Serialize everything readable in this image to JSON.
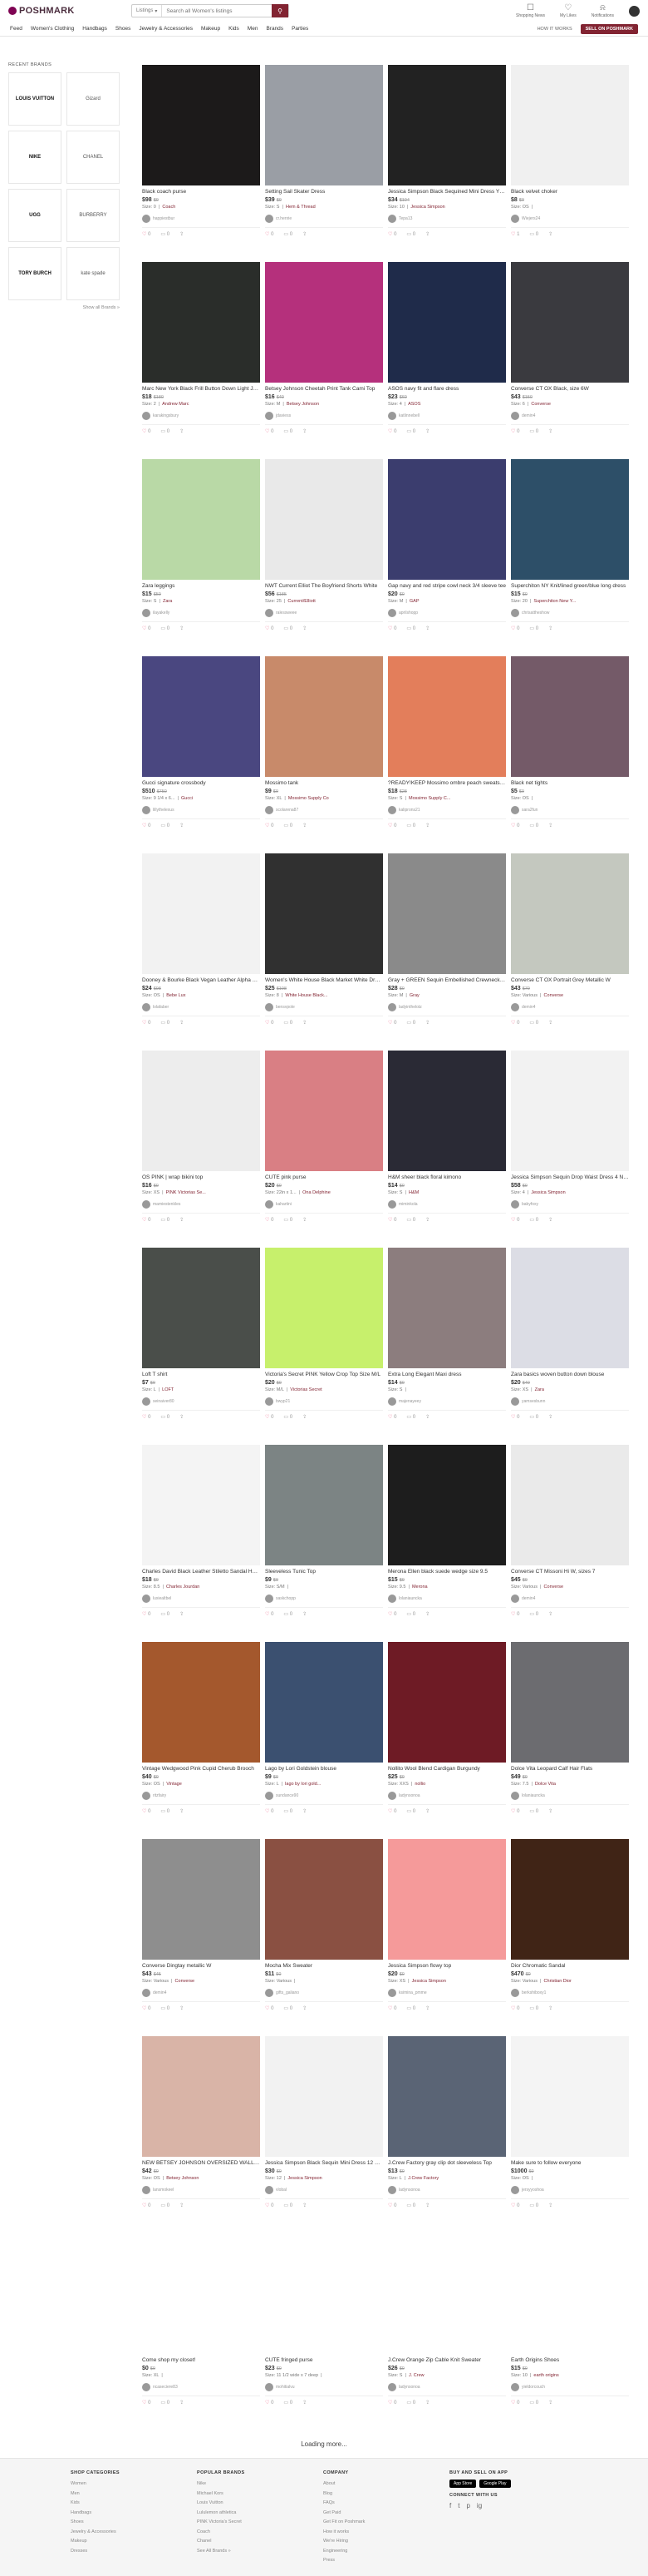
{
  "header": {
    "logo_text": "POSHMARK",
    "search_scope": "Listings",
    "search_placeholder": "Search all Women's listings",
    "icons": [
      {
        "label": "Shopping News",
        "icon": "shopping-bag-icon"
      },
      {
        "label": "My Likes",
        "icon": "heart-icon"
      },
      {
        "label": "Notifications",
        "icon": "bell-icon"
      }
    ]
  },
  "nav": {
    "items": [
      "Feed",
      "Women's Clothing",
      "Handbags",
      "Shoes",
      "Jewelry & Accessories",
      "Makeup",
      "Kids",
      "Men",
      "Brands",
      "Parties"
    ],
    "how_it_works": "HOW IT WORKS",
    "sell_label": "SELL ON POSHMARK"
  },
  "sidebar": {
    "heading": "RECENT BRANDS",
    "brands": [
      "LOUIS VUITTON",
      "Gizard",
      "NIKE",
      "CHANEL",
      "UGG",
      "BURBERRY",
      "TORY BURCH",
      "kate spade"
    ],
    "show_all": "Show all Brands »"
  },
  "listings": [
    {
      "title": "Black coach purse",
      "price": "$98",
      "orig": "$0",
      "size": "Size: 0",
      "brand": "Coach",
      "seller": "happiestbur",
      "likes": "0",
      "comments": "0",
      "color": "#1c1a1a"
    },
    {
      "title": "Setting Sail Skater Dress",
      "price": "$39",
      "orig": "$0",
      "size": "Size: S",
      "brand": "Hem & Thread",
      "seller": "cr.henrie",
      "likes": "0",
      "comments": "0",
      "color": "#9a9ea5"
    },
    {
      "title": "Jessica Simpson Black Sequined Mini Dress Y2 NWT",
      "price": "$34",
      "orig": "$104",
      "size": "Size: 10",
      "brand": "Jessica Simpson",
      "seller": "Tepa13",
      "likes": "0",
      "comments": "0",
      "color": "#222"
    },
    {
      "title": "Black velvet choker",
      "price": "$8",
      "orig": "$0",
      "size": "Size: OS",
      "brand": "",
      "seller": "Wiejers24",
      "likes": "1",
      "comments": "0",
      "color": "#f0f0f0"
    },
    {
      "title": "Marc New York Black Frill Button Down Light Jacket",
      "price": "$18",
      "orig": "$180",
      "size": "Size: 2",
      "brand": "Andrew Marc",
      "seller": "karakingsbury",
      "likes": "0",
      "comments": "0",
      "color": "#2a2d2a"
    },
    {
      "title": "Betsey Johnson Cheetah Print Tank Cami Top",
      "price": "$16",
      "orig": "$40",
      "size": "Size: M",
      "brand": "Betsey Johnson",
      "seller": "jdaviess",
      "likes": "0",
      "comments": "0",
      "color": "#b5307c"
    },
    {
      "title": "ASOS navy fit and flare dress",
      "price": "$23",
      "orig": "$60",
      "size": "Size: 4",
      "brand": "ASOS",
      "seller": "katlinnebell",
      "likes": "0",
      "comments": "0",
      "color": "#1f2b4a"
    },
    {
      "title": "Converse CT OX Black, size 6W",
      "price": "$43",
      "orig": "$150",
      "size": "Size: 6",
      "brand": "Converse",
      "seller": "demin4",
      "likes": "0",
      "comments": "0",
      "color": "#3a3a3f"
    },
    {
      "title": "Zara leggings",
      "price": "$15",
      "orig": "$50",
      "size": "Size: S",
      "brand": "Zara",
      "seller": "ilayakelly",
      "likes": "0",
      "comments": "0",
      "color": "#b9d9a6"
    },
    {
      "title": "NWT Current Elliot The Boyfriend Shorts White",
      "price": "$56",
      "orig": "$185",
      "size": "Size: 25",
      "brand": "Current/Elliott",
      "seller": "ralessweee",
      "likes": "0",
      "comments": "0",
      "color": "#e9e9e9"
    },
    {
      "title": "Gap navy and red stripe cowl neck 3/4 sleeve tee",
      "price": "$20",
      "orig": "$0",
      "size": "Size: M",
      "brand": "GAP",
      "seller": "aprilshopp",
      "likes": "0",
      "comments": "0",
      "color": "#3b3d6e"
    },
    {
      "title": "Superchiton NY Knit/lined green/blue long dress",
      "price": "$15",
      "orig": "$0",
      "size": "Size: 20",
      "brand": "Superchiton New Y...",
      "seller": "chrisattheshow",
      "likes": "0",
      "comments": "0",
      "color": "#2d4f68"
    },
    {
      "title": "Gucci signature crossbody",
      "price": "$510",
      "orig": "$750",
      "size": "Size: 9 1/4 x 6...",
      "brand": "Gucci",
      "seller": "lillythelexus",
      "likes": "0",
      "comments": "0",
      "color": "#4a4780"
    },
    {
      "title": "Mossimo tank",
      "price": "$9",
      "orig": "$0",
      "size": "Size: XL",
      "brand": "Mossimo Supply Co",
      "seller": "scolarena87",
      "likes": "0",
      "comments": "0",
      "color": "#c88a6a"
    },
    {
      "title": "?READY!KEEP Mossimo ombre peach sweatshirt",
      "price": "$18",
      "orig": "$28",
      "size": "Size: S",
      "brand": "Mossimo Supply C...",
      "seller": "kaliprons21",
      "likes": "0",
      "comments": "0",
      "color": "#e37e5b"
    },
    {
      "title": "Black net tights",
      "price": "$5",
      "orig": "$0",
      "size": "Size: OS",
      "brand": "",
      "seller": "sara2fun",
      "likes": "0",
      "comments": "0",
      "color": "#745a68"
    },
    {
      "title": "Dooney & Bourke Black Vegan Leather Alpha Shell Crossbody",
      "price": "$24",
      "orig": "$98",
      "size": "Size: OS",
      "brand": "Bebe Lux",
      "seller": "lolafaber",
      "likes": "0",
      "comments": "0",
      "color": "#f2f2f2"
    },
    {
      "title": "Women's White House Black Market White Dress Shirt",
      "price": "$25",
      "orig": "$108",
      "size": "Size: 8",
      "brand": "White House Black...",
      "seller": "bensvpole",
      "likes": "0",
      "comments": "0",
      "color": "#303030"
    },
    {
      "title": "Gray + GREEN Sequin Embellished Crewneck Sweater",
      "price": "$28",
      "orig": "$0",
      "size": "Size: M",
      "brand": "Gray",
      "seller": "ladyinthelotz",
      "likes": "0",
      "comments": "0",
      "color": "#8a8a8a"
    },
    {
      "title": "Converse CT OX Portrait Grey Metallic W",
      "price": "$43",
      "orig": "$70",
      "size": "Size: Various",
      "brand": "Converse",
      "seller": "demin4",
      "likes": "0",
      "comments": "0",
      "color": "#c4c8bf"
    },
    {
      "title": "OS PINK | wrap bikini top",
      "price": "$16",
      "orig": "$0",
      "size": "Size: XS",
      "brand": "PINK Victorias Se...",
      "seller": "mamiestenkles",
      "likes": "0",
      "comments": "0",
      "color": "#ededed"
    },
    {
      "title": "CUTE pink purse",
      "price": "$20",
      "orig": "$0",
      "size": "Size: 22in x 1...",
      "brand": "Ona Delphine",
      "seller": "kahartini",
      "likes": "0",
      "comments": "0",
      "color": "#d97f84"
    },
    {
      "title": "H&M sheer black floral kimono",
      "price": "$14",
      "orig": "$0",
      "size": "Size: S",
      "brand": "H&M",
      "seller": "miminkola",
      "likes": "0",
      "comments": "0",
      "color": "#2a2a35"
    },
    {
      "title": "Jessica Simpson Sequin Drop Waist Dress 4 NWT",
      "price": "$58",
      "orig": "$0",
      "size": "Size: 4",
      "brand": "Jessica Simpson",
      "seller": "babyfoxy",
      "likes": "0",
      "comments": "0",
      "color": "#f2f2f2"
    },
    {
      "title": "Loft T shirt",
      "price": "$7",
      "orig": "$0",
      "size": "Size: L",
      "brand": "LOFT",
      "seller": "seinaiver80",
      "likes": "0",
      "comments": "0",
      "color": "#4a4e4a"
    },
    {
      "title": "Victoria's Secret PINK Yellow Crop Top Size M/L",
      "price": "$20",
      "orig": "$0",
      "size": "Size: M/L",
      "brand": "Victorias Secret",
      "seller": "bwyp21",
      "likes": "0",
      "comments": "0",
      "color": "#c7f06c"
    },
    {
      "title": "Extra Long Elegant Maxi dress",
      "price": "$14",
      "orig": "$0",
      "size": "Size: S",
      "brand": "",
      "seller": "majenayeey",
      "likes": "0",
      "comments": "0",
      "color": "#8c7d7e"
    },
    {
      "title": "Zara basics woven button down blouse",
      "price": "$20",
      "orig": "$40",
      "size": "Size: XS",
      "brand": "Zara",
      "seller": "yamsesbunn",
      "likes": "0",
      "comments": "0",
      "color": "#dcdde5"
    },
    {
      "title": "Charles David Black Leather Stiletto Sandal Heels",
      "price": "$18",
      "orig": "$0",
      "size": "Size: 8.5",
      "brand": "Charles Jourdan",
      "seller": "luxiealtbel",
      "likes": "0",
      "comments": "0",
      "color": "#f4f4f4"
    },
    {
      "title": "Sleeveless Tunic Top",
      "price": "$9",
      "orig": "$0",
      "size": "Size: S/M",
      "brand": "",
      "seller": "saskchopp",
      "likes": "0",
      "comments": "0",
      "color": "#7c8484"
    },
    {
      "title": "Merona Ellen black suede wedge size 9.5",
      "price": "$15",
      "orig": "$0",
      "size": "Size: 9.5",
      "brand": "Merona",
      "seller": "lolaniauncka",
      "likes": "0",
      "comments": "0",
      "color": "#1d1d1d"
    },
    {
      "title": "Converse CT Missoni Hi W, sizes 7",
      "price": "$45",
      "orig": "$0",
      "size": "Size: Various",
      "brand": "Converse",
      "seller": "demin4",
      "likes": "0",
      "comments": "0",
      "color": "#eaeaea"
    },
    {
      "title": "Vintage Wedgwood Pink Cupid Cherub Brooch",
      "price": "$40",
      "orig": "$0",
      "size": "Size: OS",
      "brand": "Vintage",
      "seller": "ritzfairy",
      "likes": "0",
      "comments": "0",
      "color": "#a4582d"
    },
    {
      "title": "Lago by Lori Goldstein blouse",
      "price": "$9",
      "orig": "$0",
      "size": "Size: L",
      "brand": "lago by lori gold...",
      "seller": "sundance90",
      "likes": "0",
      "comments": "0",
      "color": "#3b5070"
    },
    {
      "title": "Nollito Wool Blend Cardigan Burgundy",
      "price": "$25",
      "orig": "$0",
      "size": "Size: XXS",
      "brand": "nollio",
      "seller": "ladynsonoa",
      "likes": "0",
      "comments": "0",
      "color": "#6e1b25"
    },
    {
      "title": "Dolce Vita Leopard Calf Hair Flats",
      "price": "$49",
      "orig": "$0",
      "size": "Size: 7.5",
      "brand": "Dolce Vita",
      "seller": "lolaniauncka",
      "likes": "0",
      "comments": "0",
      "color": "#6c6c70"
    },
    {
      "title": "Converse Dingtay metallic W",
      "price": "$43",
      "orig": "$45",
      "size": "Size: Various",
      "brand": "Converse",
      "seller": "demin4",
      "likes": "0",
      "comments": "0",
      "color": "#8e8e8e"
    },
    {
      "title": "Mocha Mix Sweater",
      "price": "$11",
      "orig": "$0",
      "size": "Size: Various",
      "brand": "",
      "seller": "gifts_galiano",
      "likes": "0",
      "comments": "0",
      "color": "#8a5042"
    },
    {
      "title": "Jessica Simpson flowy top",
      "price": "$20",
      "orig": "$0",
      "size": "Size: XS",
      "brand": "Jessica Simpson",
      "seller": "ksimina_pmme",
      "likes": "0",
      "comments": "0",
      "color": "#f59a9a"
    },
    {
      "title": "Dior Chromatic Sandal",
      "price": "$470",
      "orig": "$0",
      "size": "Size: Various",
      "brand": "Christian Dior",
      "seller": "berkshiboxy1",
      "likes": "0",
      "comments": "0",
      "color": "#402416"
    },
    {
      "title": "NEW BETSEY JOHNSON OVERSIZED WALLET ON A STRING",
      "price": "$42",
      "orig": "$0",
      "size": "Size: OS",
      "brand": "Betsey Johnson",
      "seller": "lansmokeel",
      "likes": "0",
      "comments": "0",
      "color": "#d9b4a7"
    },
    {
      "title": "Jessica Simpson Black Sequin Mini Dress 12 NWT",
      "price": "$30",
      "orig": "$0",
      "size": "Size: 12",
      "brand": "Jessica Simpson",
      "seller": "vlobal",
      "likes": "0",
      "comments": "0",
      "color": "#f2f2f2"
    },
    {
      "title": "J.Crew Factory gray clip dot sleeveless Top",
      "price": "$13",
      "orig": "$0",
      "size": "Size: L",
      "brand": "J.Crew Factory",
      "seller": "ladynsonoa",
      "likes": "0",
      "comments": "0",
      "color": "#5a6475"
    },
    {
      "title": "Make sure to follow everyone",
      "price": "$1000",
      "orig": "$0",
      "size": "Size: OS",
      "brand": "",
      "seller": "jersyyoshoa",
      "likes": "0",
      "comments": "0",
      "color": "#f4f4f4"
    },
    {
      "title": "Come shop my closet!",
      "price": "$0",
      "orig": "$0",
      "size": "Size: XL",
      "brand": "",
      "seller": "ncaseciere83",
      "likes": "0",
      "comments": "0",
      "color": "#ffffff"
    },
    {
      "title": "CUTE fringed purse",
      "price": "$23",
      "orig": "$0",
      "size": "Size: 11 1/2 wide x 7 deep",
      "brand": "",
      "seller": "mohitialvu",
      "likes": "0",
      "comments": "0",
      "color": "#ffffff"
    },
    {
      "title": "J.Crew Orange Zip Cable Knit Sweater",
      "price": "$26",
      "orig": "$0",
      "size": "Size: S",
      "brand": "J. Crew",
      "seller": "ladynsonoa",
      "likes": "0",
      "comments": "0",
      "color": "#ffffff"
    },
    {
      "title": "Earth Origins Shoes",
      "price": "$15",
      "orig": "$0",
      "size": "Size: 10",
      "brand": "earth origins",
      "seller": "yieldorcouch",
      "likes": "0",
      "comments": "0",
      "color": "#ffffff"
    }
  ],
  "loading_text": "Loading more...",
  "footer": {
    "columns": [
      {
        "heading": "SHOP CATEGORIES",
        "links": [
          "Women",
          "Men",
          "Kids",
          "Handbags",
          "Shoes",
          "Jewelry & Accessories",
          "Makeup",
          "Dresses"
        ]
      },
      {
        "heading": "POPULAR BRANDS",
        "links": [
          "Nike",
          "Michael Kors",
          "Louis Vuitton",
          "Lululemon athletica",
          "PINK Victoria's Secret",
          "Coach",
          "Chanel",
          "See All Brands »"
        ]
      },
      {
        "heading": "COMPANY",
        "links": [
          "About",
          "Blog",
          "FAQs",
          "Get Paid",
          "Get Fit on Poshmark",
          "How it works",
          "We're Hiring",
          "Engineering",
          "Press"
        ]
      },
      {
        "heading": "BUY AND SELL ON APP",
        "links": []
      }
    ],
    "app_store": "App Store",
    "google_play": "Google Play",
    "connect_heading": "CONNECT WITH US",
    "social_icons": [
      "f",
      "t",
      "p",
      "ig"
    ]
  }
}
